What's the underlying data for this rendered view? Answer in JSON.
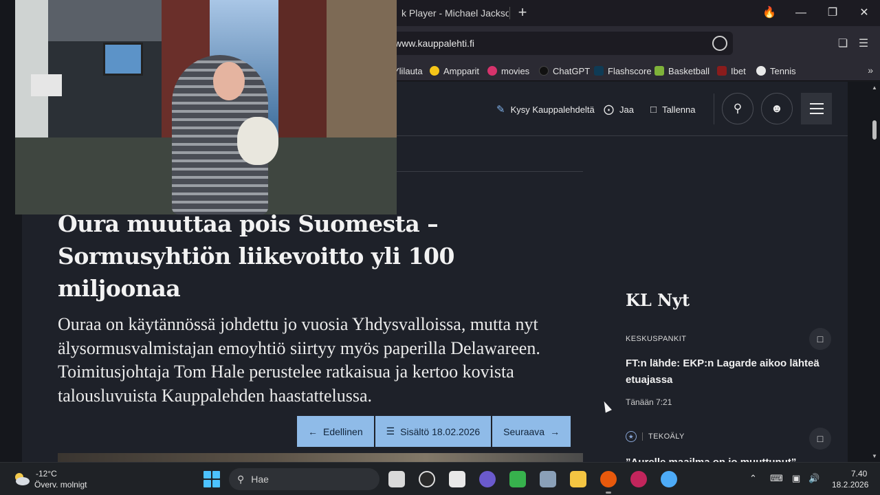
{
  "browser": {
    "tab_title": "k Player - Michael Jackson",
    "new_tab": "+",
    "url": "www.kauppalehti.fi",
    "bookmarks": [
      "Ylilauta",
      "Ampparit",
      "movies",
      "ChatGPT",
      "Flashscore",
      "Basketball",
      "Ibet",
      "Tennis"
    ],
    "bookmarks_overflow": "»"
  },
  "site_header": {
    "ask": "Kysy Kauppalehdeltä",
    "share": "Jaa",
    "save": "Tallenna"
  },
  "article": {
    "headline": "Oura muuttaa pois Suomesta – Sormusyhtiön liikevoitto yli 100 miljoonaa",
    "lead": "Ouraa on käytännössä johdettu jo vuosia Yhdysvalloissa, mutta nyt älysormusvalmistajan emoyhtiö siirtyy myös paperilla Delawareen. Toimitusjohtaja Tom Hale perustelee ratkaisua ja kertoo kovista talousluvuista Kauppalehden haastattelussa."
  },
  "pager": {
    "prev": "Edellinen",
    "contents": "Sisältö 18.02.2026",
    "next": "Seuraava"
  },
  "kl_nyt": {
    "title": "KL Nyt",
    "items": [
      {
        "category": "KESKUSPANKIT",
        "headline": "FT:n lähde: EKP:n Lagarde aikoo lähteä etuajassa",
        "time": "Tänään  7:21"
      },
      {
        "category": "TEKOÄLY",
        "headline": "”Aurelle maailma on jo muuttunut”"
      }
    ]
  },
  "taskbar": {
    "weather_temp": "-12°C",
    "weather_desc": "Överv. molnigt",
    "search_placeholder": "Hae",
    "time": "7.40",
    "date": "18.2.2026"
  },
  "colors": {
    "page_bg": "#1e2129",
    "pager_button": "#8fbbe8",
    "accent_blue": "#4cc2ff"
  }
}
